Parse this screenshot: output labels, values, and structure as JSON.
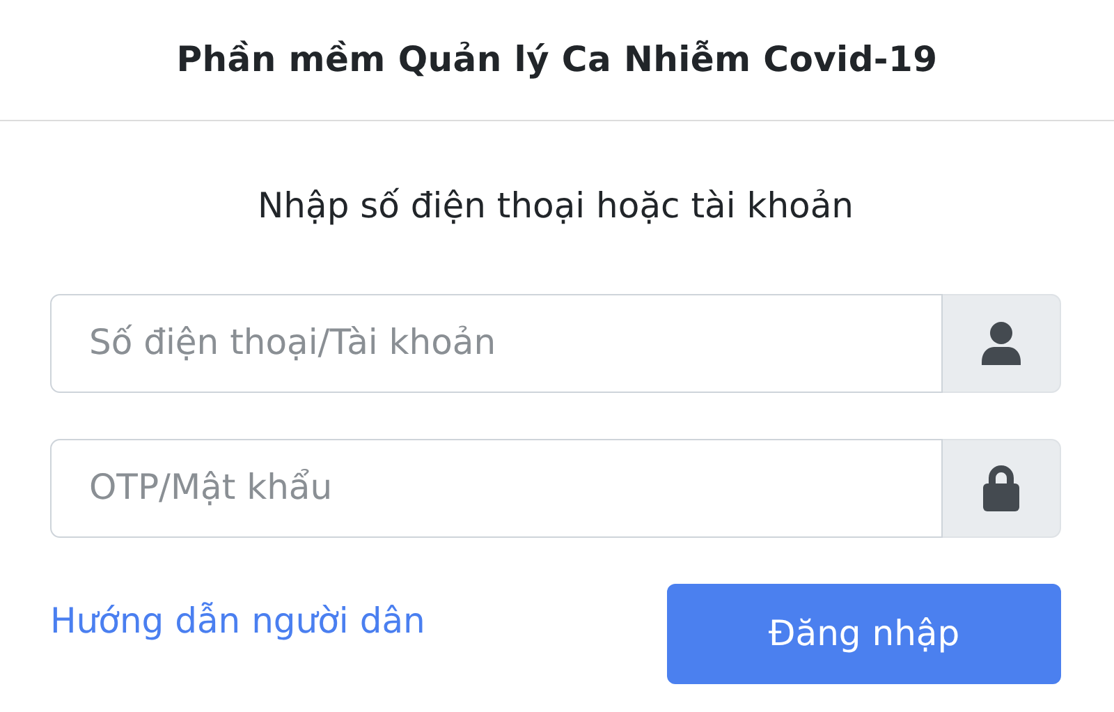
{
  "header": {
    "title": "Phần mềm Quản lý Ca Nhiễm Covid-19"
  },
  "form": {
    "heading": "Nhập số điện thoại hoặc tài khoản",
    "fields": [
      {
        "kind": "account",
        "placeholder": "Số điện thoại/Tài khoản"
      },
      {
        "kind": "password",
        "placeholder": "OTP/Mật khẩu"
      }
    ],
    "help_link": "Hướng dẫn người dân",
    "submit_button": "Đăng nhập"
  }
}
